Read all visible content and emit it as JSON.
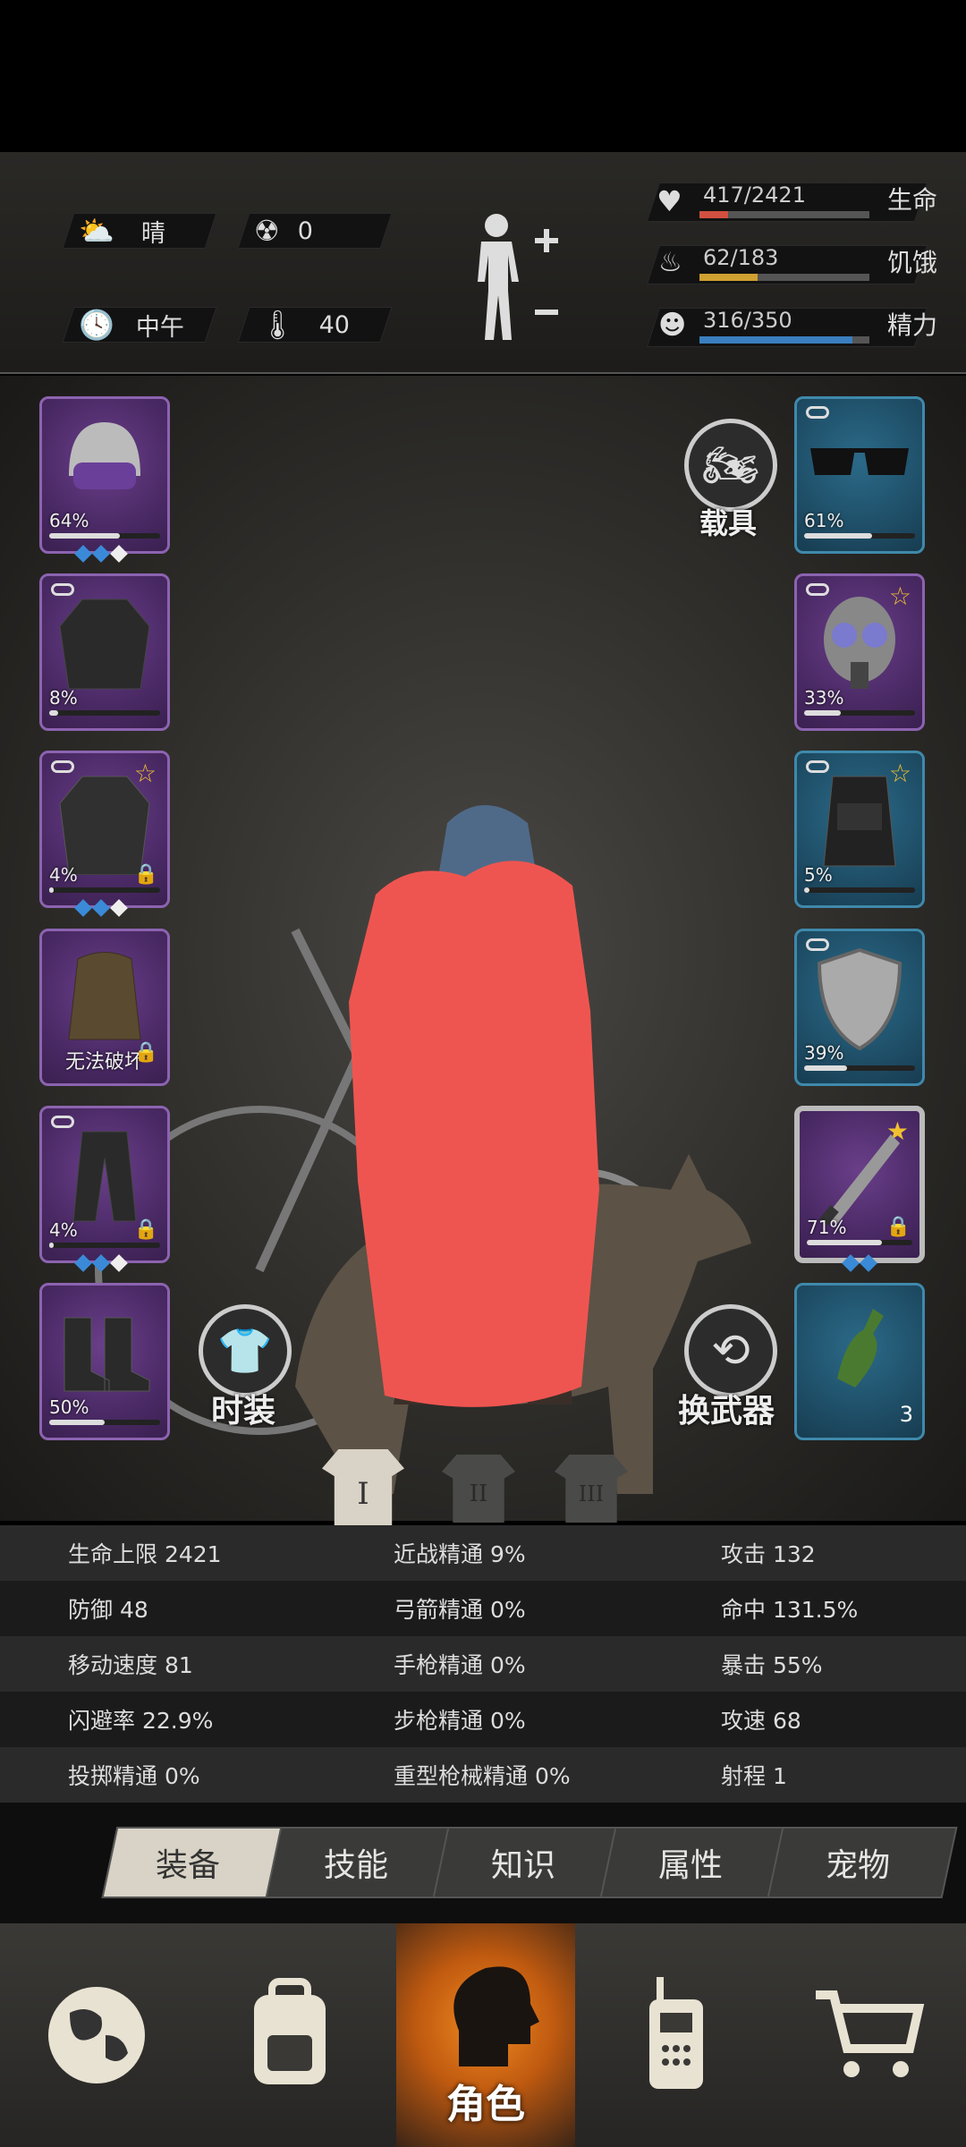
{
  "status": {
    "weather": "晴",
    "radiation": "0",
    "time_of_day": "中午",
    "temperature": "40"
  },
  "vitals": [
    {
      "value": "417/2421",
      "label": "生命",
      "fill": 0.17,
      "color": "#d05040"
    },
    {
      "value": "62/183",
      "label": "饥饿",
      "fill": 0.34,
      "color": "#d0a030"
    },
    {
      "value": "316/350",
      "label": "精力",
      "fill": 0.9,
      "color": "#3a7fc0"
    }
  ],
  "left_slots": [
    {
      "percent": "64%",
      "durability": 0.64,
      "gems": 3
    },
    {
      "percent": "8%",
      "durability": 0.08
    },
    {
      "percent": "4%",
      "durability": 0.04,
      "gems": 3
    },
    {
      "text": "无法破坏"
    },
    {
      "percent": "4%",
      "durability": 0.04,
      "gems": 3
    },
    {
      "percent": "50%",
      "durability": 0.5
    }
  ],
  "right_slots": [
    {
      "percent": "61%",
      "durability": 0.61
    },
    {
      "percent": "33%",
      "durability": 0.33
    },
    {
      "percent": "5%",
      "durability": 0.05
    },
    {
      "percent": "39%",
      "durability": 0.39
    },
    {
      "percent": "71%",
      "durability": 0.71,
      "gems": 2
    },
    {
      "count": "3"
    }
  ],
  "buttons": {
    "vehicle": "载具",
    "fashion": "时装",
    "swap_weapon": "换武器"
  },
  "loadouts": [
    "I",
    "II",
    "III"
  ],
  "stats": [
    [
      "生命上限 2421",
      "近战精通 9%",
      "攻击 132"
    ],
    [
      "防御 48",
      "弓箭精通 0%",
      "命中 131.5%"
    ],
    [
      "移动速度 81",
      "手枪精通 0%",
      "暴击 55%"
    ],
    [
      "闪避率 22.9%",
      "步枪精通 0%",
      "攻速 68"
    ],
    [
      "投掷精通 0%",
      "重型枪械精通 0%",
      "射程 1"
    ]
  ],
  "tabs": [
    "装备",
    "技能",
    "知识",
    "属性",
    "宠物"
  ],
  "bottom_nav": {
    "active_label": "角色"
  }
}
